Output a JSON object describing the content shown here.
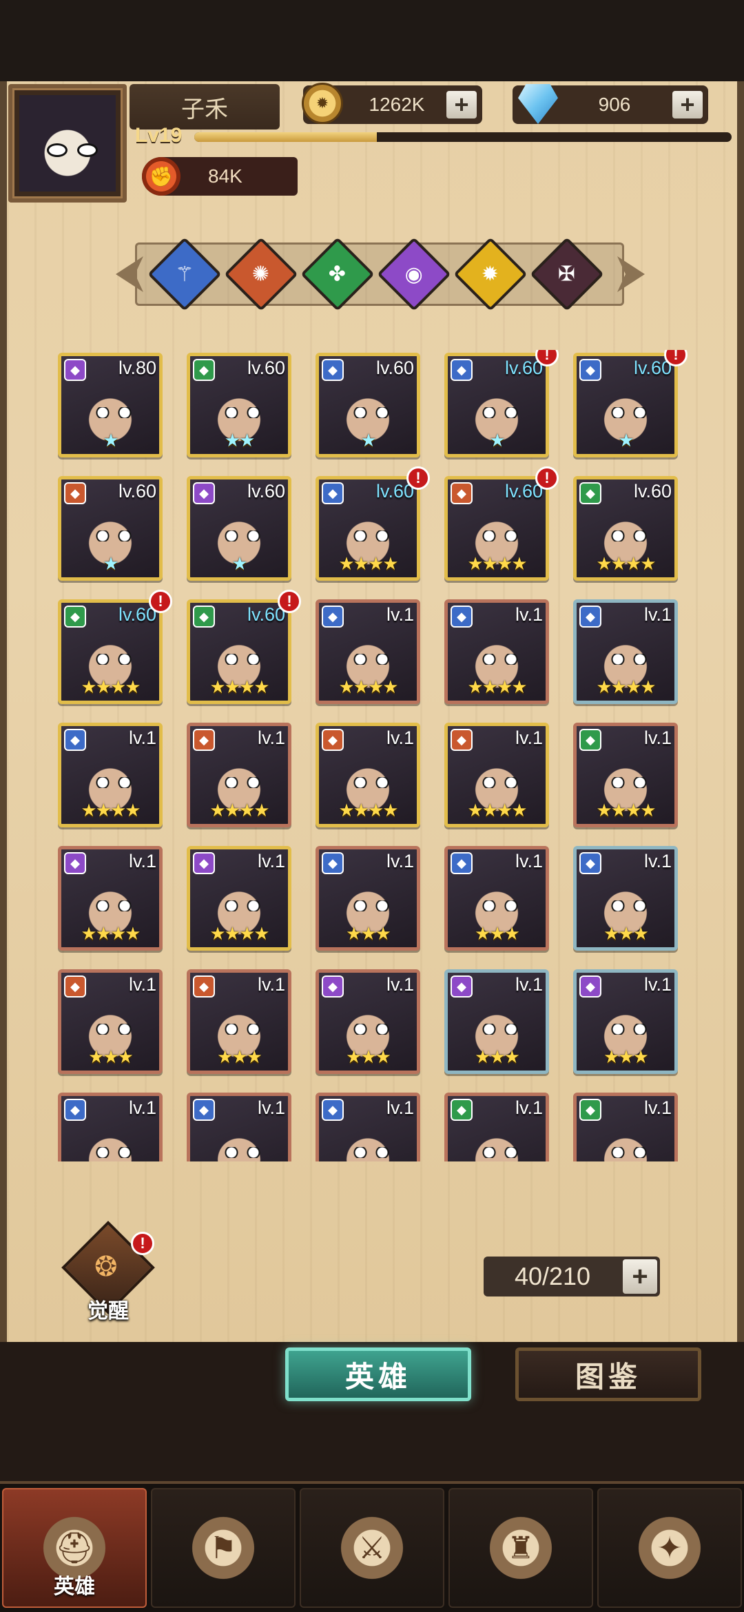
{
  "player": {
    "name": "子禾",
    "level": "Lv19",
    "xp_fraction": 0.34,
    "power": "84K"
  },
  "currencies": {
    "gold": "1262K",
    "gems": "906",
    "plus": "+"
  },
  "factions": [
    {
      "icon": "wing-icon",
      "color": "#3d6bc7"
    },
    {
      "icon": "sun-gear-icon",
      "color": "#c9582e"
    },
    {
      "icon": "clover-icon",
      "color": "#2f9a4b"
    },
    {
      "icon": "eye-icon",
      "color": "#8d4ac7"
    },
    {
      "icon": "sun-icon",
      "color": "#e3b21e"
    },
    {
      "icon": "demon-icon",
      "color": "#4a2a36"
    }
  ],
  "heroes": [
    {
      "level": "lv.80",
      "stars": "★",
      "rainbow": true,
      "alert": false,
      "frame": "gold",
      "badge": "#8d4ac7",
      "hi": false
    },
    {
      "level": "lv.60",
      "stars": "★★",
      "rainbow": true,
      "alert": false,
      "frame": "gold",
      "badge": "#2f9a4b",
      "hi": false
    },
    {
      "level": "lv.60",
      "stars": "★",
      "rainbow": true,
      "alert": false,
      "frame": "gold",
      "badge": "#3d6bc7",
      "hi": false
    },
    {
      "level": "lv.60",
      "stars": "★",
      "rainbow": true,
      "alert": true,
      "frame": "gold",
      "badge": "#3d6bc7",
      "hi": true
    },
    {
      "level": "lv.60",
      "stars": "★",
      "rainbow": true,
      "alert": true,
      "frame": "gold",
      "badge": "#3d6bc7",
      "hi": true
    },
    {
      "level": "lv.60",
      "stars": "★",
      "rainbow": true,
      "alert": false,
      "frame": "gold",
      "badge": "#c9582e",
      "hi": false
    },
    {
      "level": "lv.60",
      "stars": "★",
      "rainbow": true,
      "alert": false,
      "frame": "gold",
      "badge": "#8d4ac7",
      "hi": false
    },
    {
      "level": "lv.60",
      "stars": "★★★★",
      "rainbow": false,
      "alert": true,
      "frame": "gold",
      "badge": "#3d6bc7",
      "hi": true
    },
    {
      "level": "lv.60",
      "stars": "★★★★",
      "rainbow": false,
      "alert": true,
      "frame": "gold",
      "badge": "#c9582e",
      "hi": true
    },
    {
      "level": "lv.60",
      "stars": "★★★★",
      "rainbow": false,
      "alert": false,
      "frame": "gold",
      "badge": "#2f9a4b",
      "hi": false
    },
    {
      "level": "lv.60",
      "stars": "★★★★",
      "rainbow": false,
      "alert": true,
      "frame": "gold",
      "badge": "#2f9a4b",
      "hi": true
    },
    {
      "level": "lv.60",
      "stars": "★★★★",
      "rainbow": false,
      "alert": true,
      "frame": "gold",
      "badge": "#2f9a4b",
      "hi": true
    },
    {
      "level": "lv.1",
      "stars": "★★★★",
      "rainbow": false,
      "alert": false,
      "frame": "bronze",
      "badge": "#3d6bc7",
      "hi": false
    },
    {
      "level": "lv.1",
      "stars": "★★★★",
      "rainbow": false,
      "alert": false,
      "frame": "bronze",
      "badge": "#3d6bc7",
      "hi": false
    },
    {
      "level": "lv.1",
      "stars": "★★★★",
      "rainbow": false,
      "alert": false,
      "frame": "teal",
      "badge": "#3d6bc7",
      "hi": false
    },
    {
      "level": "lv.1",
      "stars": "★★★★",
      "rainbow": false,
      "alert": false,
      "frame": "gold",
      "badge": "#3d6bc7",
      "hi": false
    },
    {
      "level": "lv.1",
      "stars": "★★★★",
      "rainbow": false,
      "alert": false,
      "frame": "bronze",
      "badge": "#c9582e",
      "hi": false
    },
    {
      "level": "lv.1",
      "stars": "★★★★",
      "rainbow": false,
      "alert": false,
      "frame": "gold",
      "badge": "#c9582e",
      "hi": false
    },
    {
      "level": "lv.1",
      "stars": "★★★★",
      "rainbow": false,
      "alert": false,
      "frame": "gold",
      "badge": "#c9582e",
      "hi": false
    },
    {
      "level": "lv.1",
      "stars": "★★★★",
      "rainbow": false,
      "alert": false,
      "frame": "bronze",
      "badge": "#2f9a4b",
      "hi": false
    },
    {
      "level": "lv.1",
      "stars": "★★★★",
      "rainbow": false,
      "alert": false,
      "frame": "bronze",
      "badge": "#8d4ac7",
      "hi": false
    },
    {
      "level": "lv.1",
      "stars": "★★★★",
      "rainbow": false,
      "alert": false,
      "frame": "gold",
      "badge": "#8d4ac7",
      "hi": false
    },
    {
      "level": "lv.1",
      "stars": "★★★",
      "rainbow": false,
      "alert": false,
      "frame": "bronze",
      "badge": "#3d6bc7",
      "hi": false
    },
    {
      "level": "lv.1",
      "stars": "★★★",
      "rainbow": false,
      "alert": false,
      "frame": "bronze",
      "badge": "#3d6bc7",
      "hi": false
    },
    {
      "level": "lv.1",
      "stars": "★★★",
      "rainbow": false,
      "alert": false,
      "frame": "teal",
      "badge": "#3d6bc7",
      "hi": false
    },
    {
      "level": "lv.1",
      "stars": "★★★",
      "rainbow": false,
      "alert": false,
      "frame": "bronze",
      "badge": "#c9582e",
      "hi": false
    },
    {
      "level": "lv.1",
      "stars": "★★★",
      "rainbow": false,
      "alert": false,
      "frame": "bronze",
      "badge": "#c9582e",
      "hi": false
    },
    {
      "level": "lv.1",
      "stars": "★★★",
      "rainbow": false,
      "alert": false,
      "frame": "bronze",
      "badge": "#8d4ac7",
      "hi": false
    },
    {
      "level": "lv.1",
      "stars": "★★★",
      "rainbow": false,
      "alert": false,
      "frame": "teal",
      "badge": "#8d4ac7",
      "hi": false
    },
    {
      "level": "lv.1",
      "stars": "★★★",
      "rainbow": false,
      "alert": false,
      "frame": "teal",
      "badge": "#8d4ac7",
      "hi": false
    },
    {
      "level": "lv.1",
      "stars": "",
      "rainbow": false,
      "alert": false,
      "frame": "bronze",
      "badge": "#3d6bc7",
      "hi": false
    },
    {
      "level": "lv.1",
      "stars": "",
      "rainbow": false,
      "alert": false,
      "frame": "bronze",
      "badge": "#3d6bc7",
      "hi": false
    },
    {
      "level": "lv.1",
      "stars": "",
      "rainbow": false,
      "alert": false,
      "frame": "bronze",
      "badge": "#3d6bc7",
      "hi": false
    },
    {
      "level": "lv.1",
      "stars": "",
      "rainbow": false,
      "alert": false,
      "frame": "bronze",
      "badge": "#2f9a4b",
      "hi": false
    },
    {
      "level": "lv.1",
      "stars": "",
      "rainbow": false,
      "alert": false,
      "frame": "bronze",
      "badge": "#2f9a4b",
      "hi": false
    }
  ],
  "awaken": {
    "label": "觉醒",
    "alert": "!"
  },
  "capacity": {
    "value": "40/210",
    "plus": "+"
  },
  "tabs": {
    "heroes": "英雄",
    "codex": "图鉴"
  },
  "bottom_nav": [
    {
      "icon": "knight-helmet-icon",
      "label": "英雄",
      "active": true
    },
    {
      "icon": "ship-flag-icon",
      "label": "",
      "active": false
    },
    {
      "icon": "crossed-swords-icon",
      "label": "",
      "active": false
    },
    {
      "icon": "castle-icon",
      "label": "",
      "active": false
    },
    {
      "icon": "alliance-handshake-icon",
      "label": "",
      "active": false
    }
  ]
}
